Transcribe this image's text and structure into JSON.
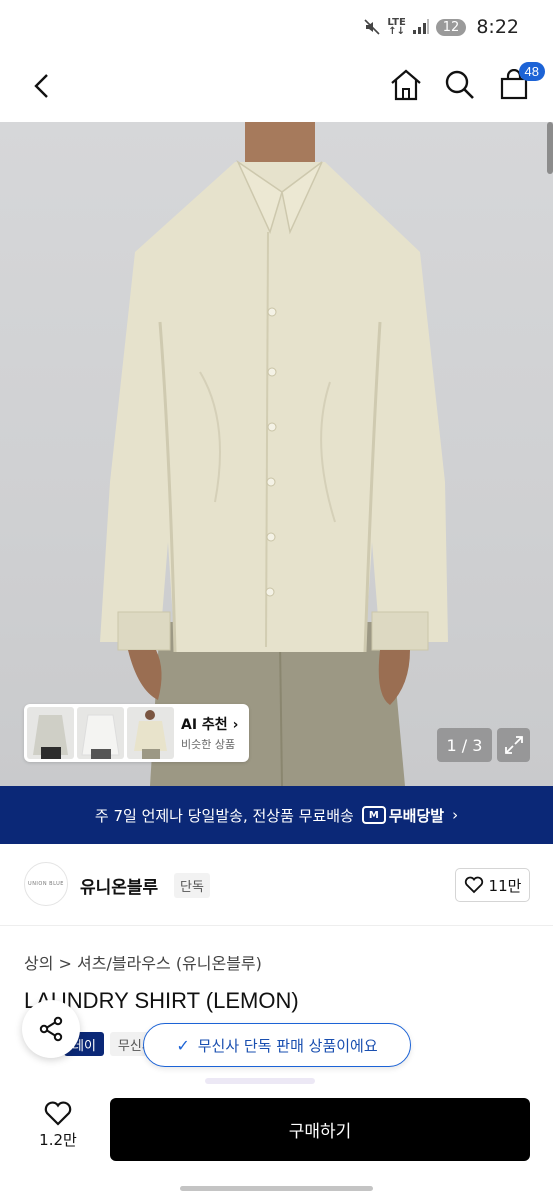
{
  "status": {
    "time": "8:22",
    "network": "LTE",
    "notification_count": "12",
    "icons": [
      "mute-icon",
      "lte-icon",
      "signal-icon"
    ]
  },
  "nav": {
    "icons": [
      "back-arrow-icon",
      "home-icon",
      "search-icon",
      "bag-icon"
    ],
    "cart_count": "48"
  },
  "gallery": {
    "counter": "1 / 3",
    "ai_title": "AI 추천",
    "ai_subtitle": "비슷한 상품",
    "thumb_count": 3
  },
  "banner": {
    "text": "주 7일 언제나 당일발송, 전상품 무료배송",
    "logo_mark": "M",
    "logo_text": "무배당발",
    "color": "#0b2877"
  },
  "brand": {
    "logo_text": "UNION BLUE",
    "name": "유니온블루",
    "tag": "단독",
    "likes": "11만"
  },
  "product": {
    "breadcrumb": "상의 > 셔츠/블라우스 (유니온블루)",
    "title": "LAUNDRY SHIRT (LEMON)",
    "tag_primary": "데이",
    "tag_secondary": "무신사"
  },
  "toast": {
    "text": "무신사 단독 판매 상품이에요",
    "accent": "#1c63d6"
  },
  "bottom": {
    "wish_count": "1.2만",
    "buy_label": "구매하기"
  }
}
